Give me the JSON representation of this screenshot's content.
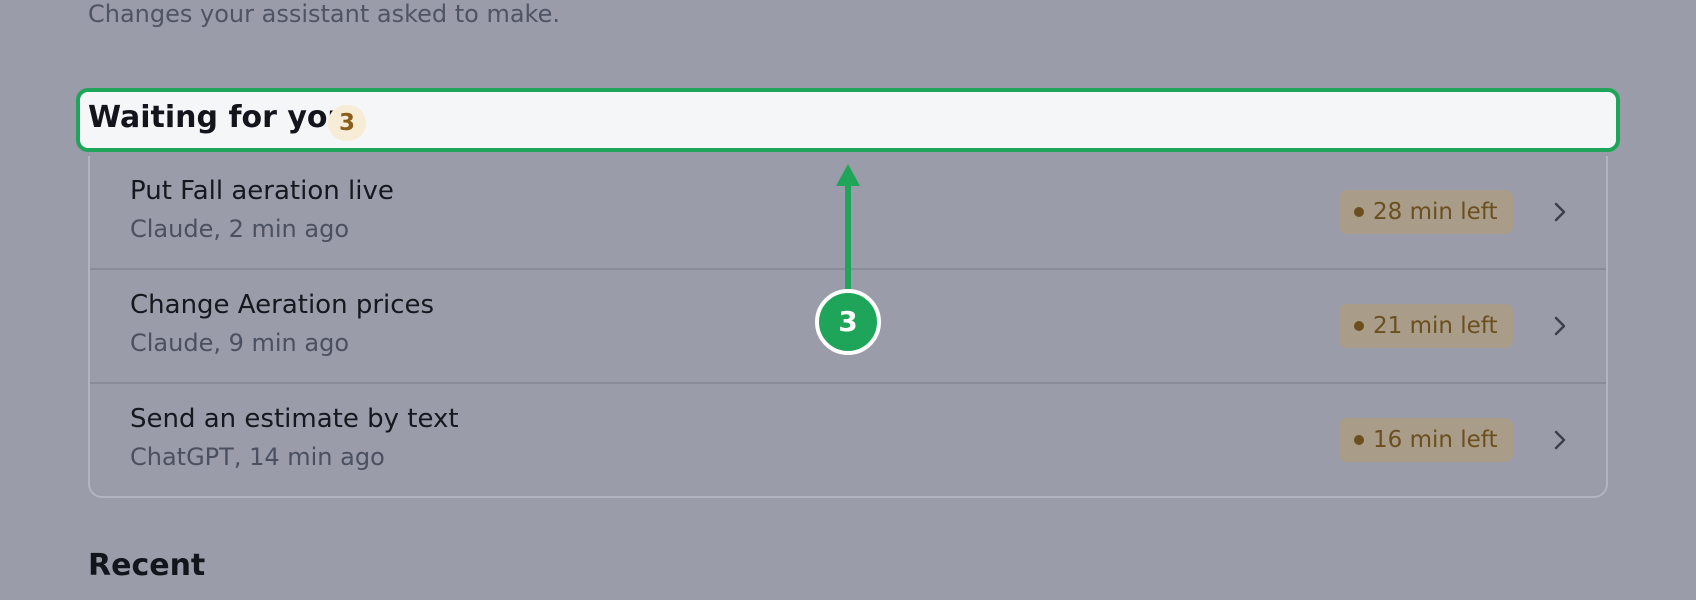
{
  "header": {
    "subtitle": "Changes your assistant asked to make."
  },
  "waiting_section": {
    "title": "Waiting for you",
    "count": "3",
    "items": [
      {
        "title": "Put Fall aeration live",
        "meta": "Claude, 2 min ago",
        "time_left": "28 min left"
      },
      {
        "title": "Change Aeration prices",
        "meta": "Claude, 9 min ago",
        "time_left": "21 min left"
      },
      {
        "title": "Send an estimate by text",
        "meta": "ChatGPT, 14 min ago",
        "time_left": "16 min left"
      }
    ]
  },
  "recent_section": {
    "title": "Recent"
  },
  "annotation": {
    "step_number": "3",
    "color": "#1ea559"
  },
  "colors": {
    "background": "#9a9ca9",
    "highlight_border": "#1ea559",
    "time_pill_text": "#6b4f1f"
  },
  "icons": {
    "row_chevron": "chevron-right-icon",
    "status_dot": "status-dot-icon",
    "annotation_arrow": "arrow-up-icon"
  }
}
